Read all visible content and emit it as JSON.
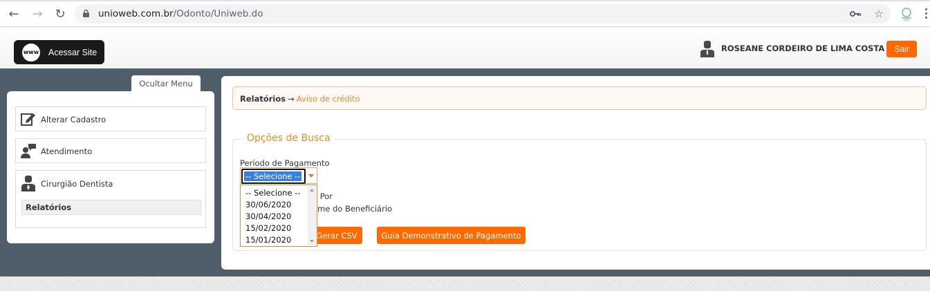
{
  "browser": {
    "url_host": "unioweb.com.br",
    "url_path": "/Odonto/Uniweb.do",
    "icons": [
      "back-icon",
      "forward-icon",
      "reload-icon",
      "lock-icon",
      "key-icon",
      "star-icon",
      "extension-icon",
      "menu-kebab-icon"
    ]
  },
  "header": {
    "site_button_badge": "www",
    "site_button_label": "Acessar Site",
    "user_name": "ROSEANE CORDEIRO DE LIMA COSTA",
    "logout_label": "Sair"
  },
  "sidebar": {
    "toggle_label": "Ocultar Menu",
    "items": [
      {
        "label": "Alterar Cadastro",
        "icon": "edit-icon"
      },
      {
        "label": "Atendimento",
        "icon": "chat-user-icon"
      },
      {
        "label": "Cirurgião Dentista",
        "icon": "dentist-icon"
      }
    ],
    "sub_items": [
      {
        "label": "Relatórios",
        "active": true
      }
    ]
  },
  "main": {
    "breadcrumb": {
      "root": "Relatórios",
      "separator": "→",
      "current": "Aviso de crédito"
    },
    "search_legend": "Opções de Busca",
    "period_label": "Período de Pagamento",
    "period_select": {
      "selected": "-- Selecione --",
      "options": [
        "-- Selecione --",
        "30/06/2020",
        "30/04/2020",
        "15/02/2020",
        "15/01/2020"
      ]
    },
    "order_label_partial": "o Por",
    "order_option_partial": "ome do Beneficiário",
    "csv_button_partial": "Gerar CSV",
    "guide_button": "Guia Demonstrativo de Pagamento"
  },
  "colors": {
    "accent": "#ff6a00",
    "accent_text": "#e98a2c",
    "band": "#505e6b",
    "selection": "#3a7fdc"
  }
}
